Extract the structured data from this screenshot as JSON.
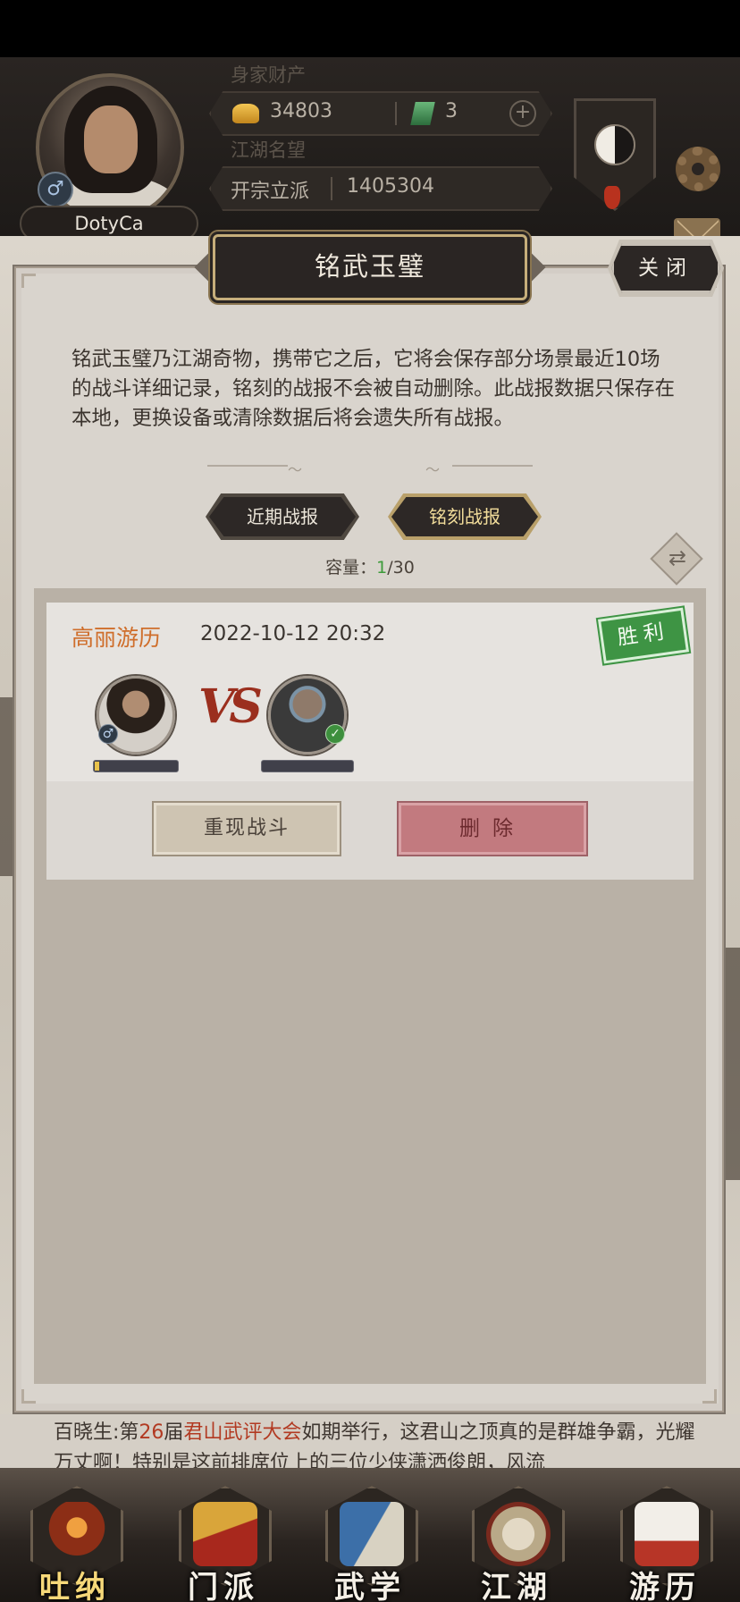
{
  "hud": {
    "avatar_name": "DotyCa",
    "gender_symbol": "♂",
    "wealth_label": "身家财产",
    "gold_amount": "34803",
    "jade_amount": "3",
    "plus_symbol": "+",
    "reputation_label": "江湖名望",
    "reputation_title": "开宗立派",
    "reputation_value": "1405304",
    "shield_dash": "-"
  },
  "dialog": {
    "title": "铭武玉璧",
    "close_label": "关闭",
    "description": "铭武玉璧乃江湖奇物，携带它之后，它将会保存部分场景最近10场的战斗详细记录，铭刻的战报不会被自动删除。此战报数据只保存在本地，更换设备或清除数据后将会遗失所有战报。",
    "tabs": [
      {
        "label": "近期战报",
        "active": false
      },
      {
        "label": "铭刻战报",
        "active": true
      }
    ],
    "capacity_label": "容量：",
    "capacity_used": "1",
    "capacity_total": "/30",
    "swap_icon": "refresh-icon"
  },
  "records": [
    {
      "scene": "高丽游历",
      "datetime": "2022-10-12 20:32",
      "result": "胜利",
      "vs_text": "VS",
      "player_badge": "♂",
      "enemy_badge": "✓",
      "replay_label": "重现战斗",
      "delete_label": "删除"
    }
  ],
  "ticker": {
    "prefix": "百晓生:第",
    "num": "26",
    "mid": "届",
    "event": "君山武评大会",
    "rest": "如期举行，这君山之顶真的是群雄争霸，光耀万丈啊！特别是这前排席位上的三位少侠潇洒俊朗，风流"
  },
  "nav": [
    {
      "label": "吐纳",
      "icon": "meditation-icon",
      "active": true
    },
    {
      "label": "门派",
      "icon": "sect-banner-icon",
      "active": false
    },
    {
      "label": "武学",
      "icon": "scroll-book-icon",
      "active": false
    },
    {
      "label": "江湖",
      "icon": "bamboo-hat-icon",
      "active": false
    },
    {
      "label": "游历",
      "icon": "horse-icon",
      "active": false
    }
  ],
  "colors": {
    "victory": "#3e9444",
    "scene_orange": "#cf6e2b",
    "delete_red": "#c27a7f",
    "capacity_green": "#3d9b3a"
  }
}
